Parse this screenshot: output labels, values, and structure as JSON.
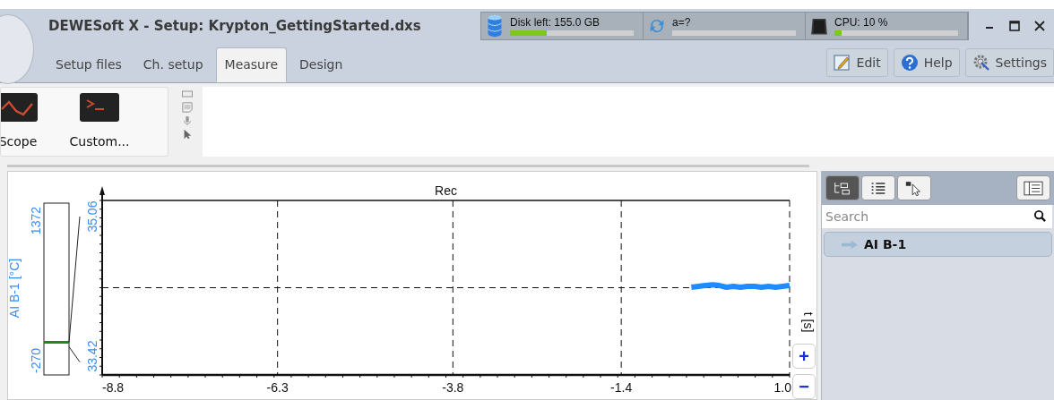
{
  "window": {
    "title": "DEWESoft X - Setup: Krypton_GettingStarted.dxs"
  },
  "status_meters": [
    {
      "kind": "disk",
      "label": "Disk left: 155.0 GB",
      "level": 0.3
    },
    {
      "kind": "sync",
      "label": "a=?",
      "level": 0
    },
    {
      "kind": "cpu",
      "label": "CPU: 10 %",
      "level": 0.06
    }
  ],
  "tabs": [
    {
      "label": "Setup files",
      "selected": false
    },
    {
      "label": "Ch. setup",
      "selected": false
    },
    {
      "label": "Measure",
      "selected": true
    },
    {
      "label": "Design",
      "selected": false
    }
  ],
  "header_buttons": [
    {
      "kind": "edit",
      "label": "Edit"
    },
    {
      "kind": "help",
      "label": "Help"
    },
    {
      "kind": "settings",
      "label": "Settings"
    }
  ],
  "toolbar": [
    {
      "kind": "scope",
      "label": "Scope"
    },
    {
      "kind": "custom",
      "label": "Custom..."
    }
  ],
  "chart": {
    "meter": {
      "max": "1372",
      "min": "-270",
      "level": 0.19
    },
    "chart_data": {
      "type": "line",
      "title": "Rec",
      "grid": true,
      "xlim": [
        -8.8,
        1.0
      ],
      "ylim": [
        33.2,
        35.25
      ],
      "xticks": [
        {
          "value": -8.8,
          "label": "-8.8"
        },
        {
          "value": -6.3,
          "label": "-6.3"
        },
        {
          "value": -3.8,
          "label": "-3.8"
        },
        {
          "value": -1.4,
          "label": "-1.4"
        },
        {
          "value": 1.0,
          "label": "1.0"
        }
      ],
      "yticks": [
        {
          "value": 33.42,
          "label": "33.42"
        },
        {
          "value": 35.06,
          "label": "35.06"
        }
      ],
      "annotations": [
        {
          "text": "AI B-1 [°C]"
        },
        {
          "text": "t [s]"
        }
      ],
      "x": [
        -0.4,
        -0.3,
        -0.2,
        -0.1,
        0.0,
        0.1,
        0.2,
        0.3,
        0.4,
        0.5,
        0.6,
        0.7,
        0.8,
        0.9,
        1.0
      ],
      "series": [
        {
          "color": "#1e8cff",
          "values": [
            34.23,
            34.24,
            34.25,
            34.26,
            34.25,
            34.23,
            34.24,
            34.23,
            34.24,
            34.24,
            34.23,
            34.24,
            34.23,
            34.24,
            34.25
          ]
        }
      ]
    },
    "zoom_buttons": [
      "+",
      "−"
    ]
  },
  "side_panel": {
    "views": [
      {
        "kind": "tree",
        "selected": true
      },
      {
        "kind": "list",
        "selected": false
      },
      {
        "kind": "pointer",
        "selected": false
      }
    ],
    "search": {
      "placeholder": "Search"
    },
    "channels": [
      {
        "name": "AI B-1",
        "selected": false
      }
    ]
  }
}
